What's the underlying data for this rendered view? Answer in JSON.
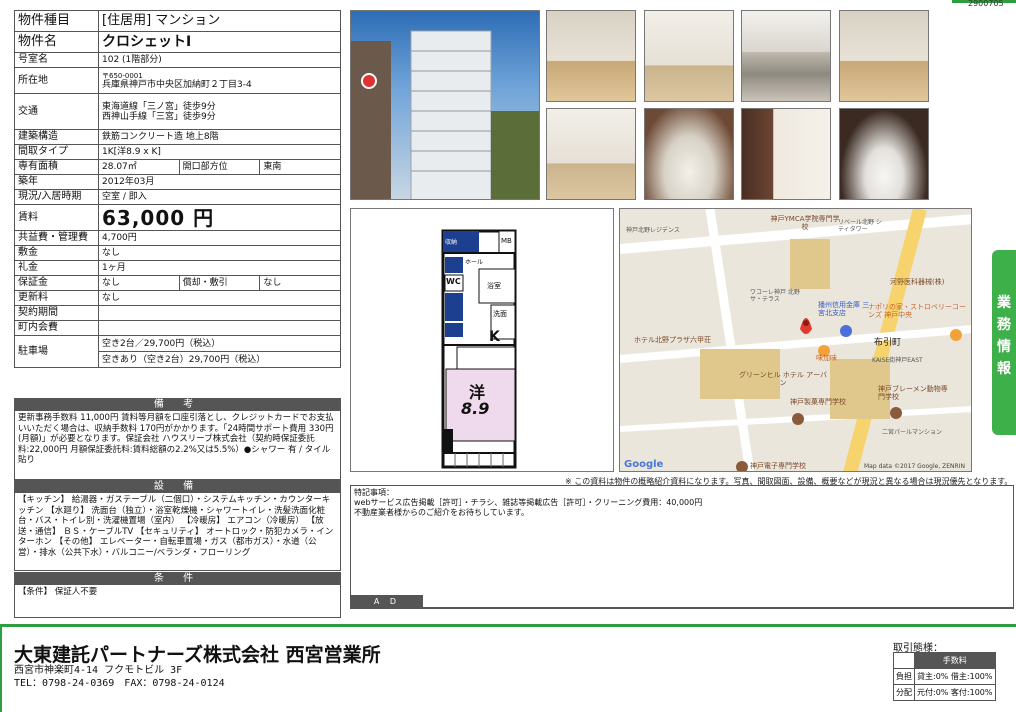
{
  "doc_number": "2900705",
  "property": {
    "type_label": "物件種目",
    "type_value": "[住居用] マンション",
    "name_label": "物件名",
    "name_value": "クロシェットI",
    "room_label": "号室名",
    "room_value": "102 (1階部分)",
    "address_label": "所在地",
    "postal": "〒650-0001",
    "address_value": "兵庫県神戸市中央区加納町２丁目3-4",
    "transport_label": "交通",
    "transport_1": "東海道線「三ノ宮」徒歩9分",
    "transport_2": "西神山手線「三宮」徒歩9分",
    "structure_label": "建築構造",
    "structure_value": "鉄筋コンクリート造 地上8階",
    "layout_label": "間取タイプ",
    "layout_value": "1K[洋8.9 x K]",
    "area_label": "専有面積",
    "area_value": "28.07㎡",
    "direction_label": "開口部方位",
    "direction_value": "東南",
    "built_label": "築年",
    "built_value": "2012年03月",
    "status_label": "現況/入居時期",
    "status_value": "空室 / 即入",
    "rent_label": "賃料",
    "rent_value": "63,000 円",
    "fee_label": "共益費・管理費",
    "fee_value": "4,700円",
    "deposit_label": "敷金",
    "deposit_value": "なし",
    "keymoney_label": "礼金",
    "keymoney_value": "1ヶ月",
    "guarantee_label": "保証金",
    "guarantee_value": "なし",
    "amort_label": "償却・敷引",
    "amort_value": "なし",
    "renewal_label": "更新料",
    "renewal_value": "なし",
    "contract_label": "契約期間",
    "contract_value": "",
    "community_label": "町内会費",
    "community_value": "",
    "parking_label": "駐車場",
    "parking_1": "空き2台／29,700円（税込）",
    "parking_2": "空きあり（空き2台）29,700円（税込）"
  },
  "remarks": {
    "title": "備 考",
    "text": "更新事務手数料 11,000円 賃料等月額を口座引落とし、クレジットカードでお支払いいただく場合は、収納手数料 170円がかかります。「24時間サポート費用 330円(月額)」が必要となります。保証会社 ハウスリーブ株式会社（契約時保証委託料:22,000円 月額保証委託料:賃料総額の2.2%又は5.5%）●シャワー 有 / タイル貼り"
  },
  "facilities": {
    "title": "設 備",
    "text": "【キッチン】 給湯器・ガステーブル（二個口）・システムキッチン・カウンターキッチン 【水廻り】 洗面台（独立）・浴室乾燥機・シャワートイレ・洗髪洗面化粧台・バス・トイレ別・洗濯機置場（室内） 【冷暖房】 エアコン（冷暖房） 【放送・通信】 ＢＳ・ケーブルTV 【セキュリティ】 オートロック・防犯カメラ・インターホン 【その他】 エレベーター・自転車置場・ガス（都市ガス）・水道（公営）・排水（公共下水）・バルコニー/ベランダ・フローリング"
  },
  "conditions": {
    "title": "条 件",
    "text": "【条件】 保証人不要"
  },
  "floorplan": {
    "yo_label": "洋",
    "yo_size": "8.9",
    "k_label": "K",
    "bath_label": "浴室",
    "wc_label": "WC",
    "wash_label": "洗面",
    "storage_label": "収納",
    "mb_label": "MB",
    "hall_label": "ホール"
  },
  "map": {
    "labels": {
      "ymca": "神戸YMCA学院専門学校",
      "hotel": "ホテル北野プラザ六甲荘",
      "bank": "播州信用金庫 三宮北支店",
      "nunobiki": "布引町",
      "kawano": "河野医科器械(株)",
      "napoli": "ナポリの家・ストロベリーコーンズ 神戸中央",
      "ajikari": "味加味",
      "green": "グリーンヒル ホテル アーバン",
      "seiyaku": "神戸製菓専門学校",
      "bremen": "神戸ブレーメン動物専門学校",
      "denshi": "神戸電子専門学校",
      "kaise": "KAISE街神戸EAST",
      "nichome": "二宮パールマンション",
      "kitano": "神戸北野レジデンス",
      "wacole": "ワコーレ神戸 北野サ・テラス",
      "rivale": "リベール北野 シティタワー",
      "google": "Google",
      "credit": "Map data ©2017 Google, ZENRIN"
    }
  },
  "note": "※ この資料は物件の概略紹介資料になります。写真、間取図面、設備、概要などが現況と異なる場合は現況優先となります。",
  "special": {
    "text_1": "特記事項：",
    "text_2": "webサービス広告掲載［許可］・チラシ、雑誌等掲載広告［許可］・クリーニング費用：40,000円",
    "text_3": "不動産業者様からのご紹介をお待ちしています。",
    "ad_label": "A D"
  },
  "side_tab": "業務情報",
  "company": {
    "name": "大東建託パートナーズ株式会社 西宮営業所",
    "address": "西宮市神楽町4-14 フクモトビル 3F",
    "tel": "TEL：0798-24-0369　FAX：0798-24-0124"
  },
  "deal": {
    "title": "取引態様：",
    "header": "手数料",
    "row1_label": "負担",
    "row1_value": "貸主:0% 借主:100%",
    "row2_label": "分配",
    "row2_value": "元付:0% 客付:100%"
  },
  "photos": [
    "building",
    "room-window",
    "room-counter",
    "kitchen",
    "bathroom",
    "corridor",
    "bath-dark",
    "entrance",
    "toilet"
  ]
}
